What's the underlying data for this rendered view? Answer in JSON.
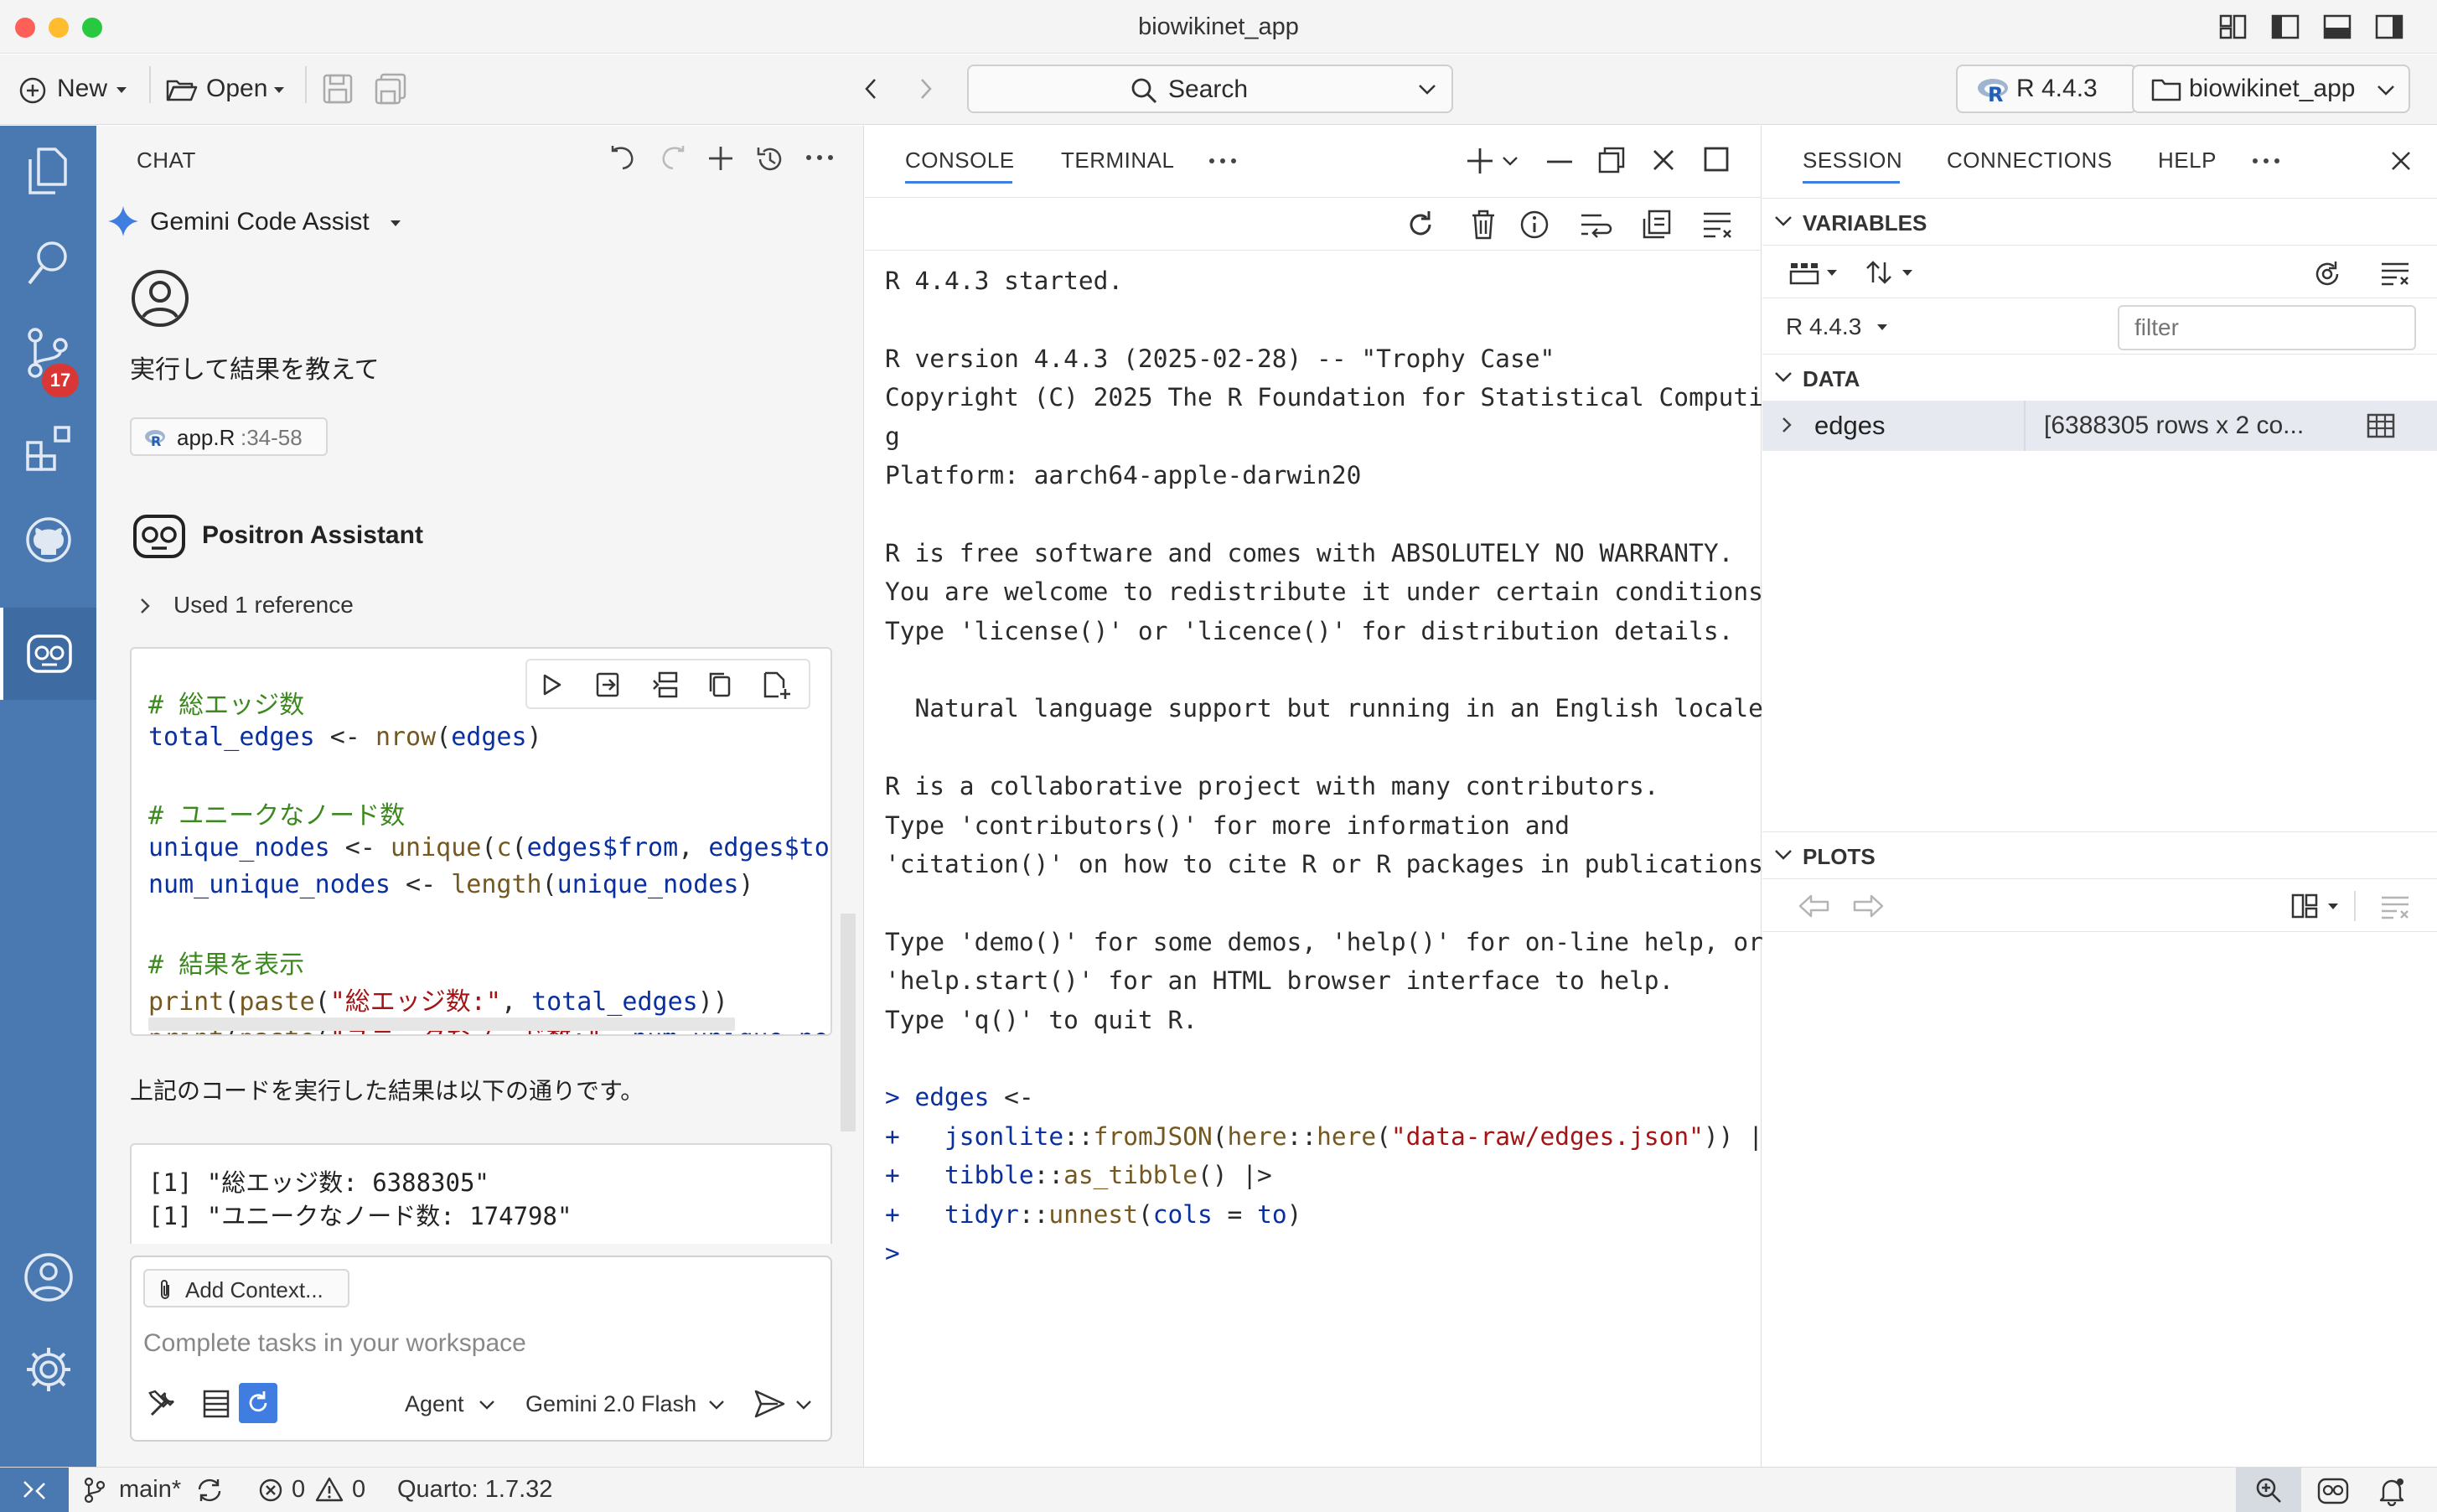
{
  "window": {
    "title": "biowikinet_app"
  },
  "toolbar": {
    "new_label": "New",
    "open_label": "Open",
    "search_label": "Search",
    "r_version": "R 4.4.3",
    "project": "biowikinet_app"
  },
  "activity": {
    "badge_count": "17"
  },
  "chat": {
    "header": "CHAT",
    "assistant_selector": "Gemini Code Assist",
    "user_message": "実行して結果を教えて",
    "file_chip_name": "app.R",
    "file_chip_range": ":34-58",
    "assistant_name": "Positron Assistant",
    "used_reference": "Used 1 reference",
    "code_lines": [
      {
        "cls": "c-cmt",
        "parts": [
          [
            "c-cmt",
            "# 総エッジ数"
          ]
        ]
      },
      {
        "parts": [
          [
            "c-var",
            "total_edges"
          ],
          [
            "c-op",
            " <- "
          ],
          [
            "c-fn",
            "nrow"
          ],
          [
            "c-op",
            "("
          ],
          [
            "c-var",
            "edges"
          ],
          [
            "c-op",
            ")"
          ]
        ]
      },
      {
        "parts": []
      },
      {
        "parts": [
          [
            "c-cmt",
            "# ユニークなノード数"
          ]
        ]
      },
      {
        "parts": [
          [
            "c-var",
            "unique_nodes"
          ],
          [
            "c-op",
            " <- "
          ],
          [
            "c-fn",
            "unique"
          ],
          [
            "c-op",
            "("
          ],
          [
            "c-fn",
            "c"
          ],
          [
            "c-op",
            "("
          ],
          [
            "c-var",
            "edges$from"
          ],
          [
            "c-op",
            ", "
          ],
          [
            "c-var",
            "edges$to"
          ],
          [
            "c-op",
            ")"
          ]
        ]
      },
      {
        "parts": [
          [
            "c-var",
            "num_unique_nodes"
          ],
          [
            "c-op",
            " <- "
          ],
          [
            "c-fn",
            "length"
          ],
          [
            "c-op",
            "("
          ],
          [
            "c-var",
            "unique_nodes"
          ],
          [
            "c-op",
            ")"
          ]
        ]
      },
      {
        "parts": []
      },
      {
        "parts": [
          [
            "c-cmt",
            "# 結果を表示"
          ]
        ]
      },
      {
        "parts": [
          [
            "c-fn",
            "print"
          ],
          [
            "c-op",
            "("
          ],
          [
            "c-fn",
            "paste"
          ],
          [
            "c-op",
            "("
          ],
          [
            "c-str",
            "\"総エッジ数:\""
          ],
          [
            "c-op",
            ", "
          ],
          [
            "c-var",
            "total_edges"
          ],
          [
            "c-op",
            "))"
          ]
        ]
      },
      {
        "parts": [
          [
            "c-fn",
            "print"
          ],
          [
            "c-op",
            "("
          ],
          [
            "c-fn",
            "paste"
          ],
          [
            "c-op",
            "("
          ],
          [
            "c-str",
            "\"ユニークなノード数:\""
          ],
          [
            "c-op",
            ", "
          ],
          [
            "c-var",
            "num_unique_nod"
          ]
        ]
      }
    ],
    "result_intro": "上記のコードを実行した結果は以下の通りです。",
    "output_lines": [
      "[1] \"総エッジ数: 6388305\"",
      "[1] \"ユニークなノード数: 174798\""
    ],
    "add_context": "Add Context...",
    "input_placeholder": "Complete tasks in your workspace",
    "mode": "Agent",
    "model": "Gemini 2.0 Flash"
  },
  "console": {
    "tabs": [
      "CONSOLE",
      "TERMINAL"
    ],
    "lines": [
      [
        [
          "c-op",
          "R 4.4.3 started."
        ]
      ],
      [],
      [
        [
          "c-op",
          "R version 4.4.3 (2025-02-28) -- \"Trophy Case\""
        ]
      ],
      [
        [
          "c-op",
          "Copyright (C) 2025 The R Foundation for Statistical Computin"
        ]
      ],
      [
        [
          "c-op",
          "g"
        ]
      ],
      [
        [
          "c-op",
          "Platform: aarch64-apple-darwin20"
        ]
      ],
      [],
      [
        [
          "c-op",
          "R is free software and comes with ABSOLUTELY NO WARRANTY."
        ]
      ],
      [
        [
          "c-op",
          "You are welcome to redistribute it under certain conditions."
        ]
      ],
      [
        [
          "c-op",
          "Type 'license()' or 'licence()' for distribution details."
        ]
      ],
      [],
      [
        [
          "c-op",
          "  Natural language support but running in an English locale"
        ]
      ],
      [],
      [
        [
          "c-op",
          "R is a collaborative project with many contributors."
        ]
      ],
      [
        [
          "c-op",
          "Type 'contributors()' for more information and"
        ]
      ],
      [
        [
          "c-op",
          "'citation()' on how to cite R or R packages in publications."
        ]
      ],
      [],
      [
        [
          "c-op",
          "Type 'demo()' for some demos, 'help()' for on-line help, or"
        ]
      ],
      [
        [
          "c-op",
          "'help.start()' for an HTML browser interface to help."
        ]
      ],
      [
        [
          "c-op",
          "Type 'q()' to quit R."
        ]
      ],
      [],
      [
        [
          "c-var",
          "> "
        ],
        [
          "c-var",
          "edges"
        ],
        [
          "c-op",
          " <-"
        ]
      ],
      [
        [
          "c-var",
          "+   "
        ],
        [
          "c-var",
          "jsonlite"
        ],
        [
          "c-op",
          "::"
        ],
        [
          "c-fn",
          "fromJSON"
        ],
        [
          "c-op",
          "("
        ],
        [
          "c-fn",
          "here"
        ],
        [
          "c-op",
          "::"
        ],
        [
          "c-fn",
          "here"
        ],
        [
          "c-op",
          "("
        ],
        [
          "c-str",
          "\"data-raw/edges.json\""
        ],
        [
          "c-op",
          ")) |>"
        ]
      ],
      [
        [
          "c-var",
          "+   "
        ],
        [
          "c-var",
          "tibble"
        ],
        [
          "c-op",
          "::"
        ],
        [
          "c-fn",
          "as_tibble"
        ],
        [
          "c-op",
          "() |>"
        ]
      ],
      [
        [
          "c-var",
          "+   "
        ],
        [
          "c-var",
          "tidyr"
        ],
        [
          "c-op",
          "::"
        ],
        [
          "c-fn",
          "unnest"
        ],
        [
          "c-op",
          "("
        ],
        [
          "c-var",
          "cols"
        ],
        [
          "c-op",
          " = "
        ],
        [
          "c-var",
          "to"
        ],
        [
          "c-op",
          ")"
        ]
      ],
      [
        [
          "c-var",
          ">"
        ]
      ]
    ]
  },
  "session": {
    "tabs": [
      "SESSION",
      "CONNECTIONS",
      "HELP"
    ],
    "variables_header": "VARIABLES",
    "r_selector": "R 4.4.3",
    "filter_placeholder": "filter",
    "data_header": "DATA",
    "variable_name": "edges",
    "variable_value": "[6388305 rows x 2 co...",
    "plots_header": "PLOTS"
  },
  "status": {
    "branch": "main*",
    "errors": "0",
    "warnings": "0",
    "quarto": "Quarto: 1.7.32"
  },
  "colors": {
    "accent": "#4a78b0",
    "activity_bar": "#4a78b0",
    "error_badge": "#d93636"
  }
}
